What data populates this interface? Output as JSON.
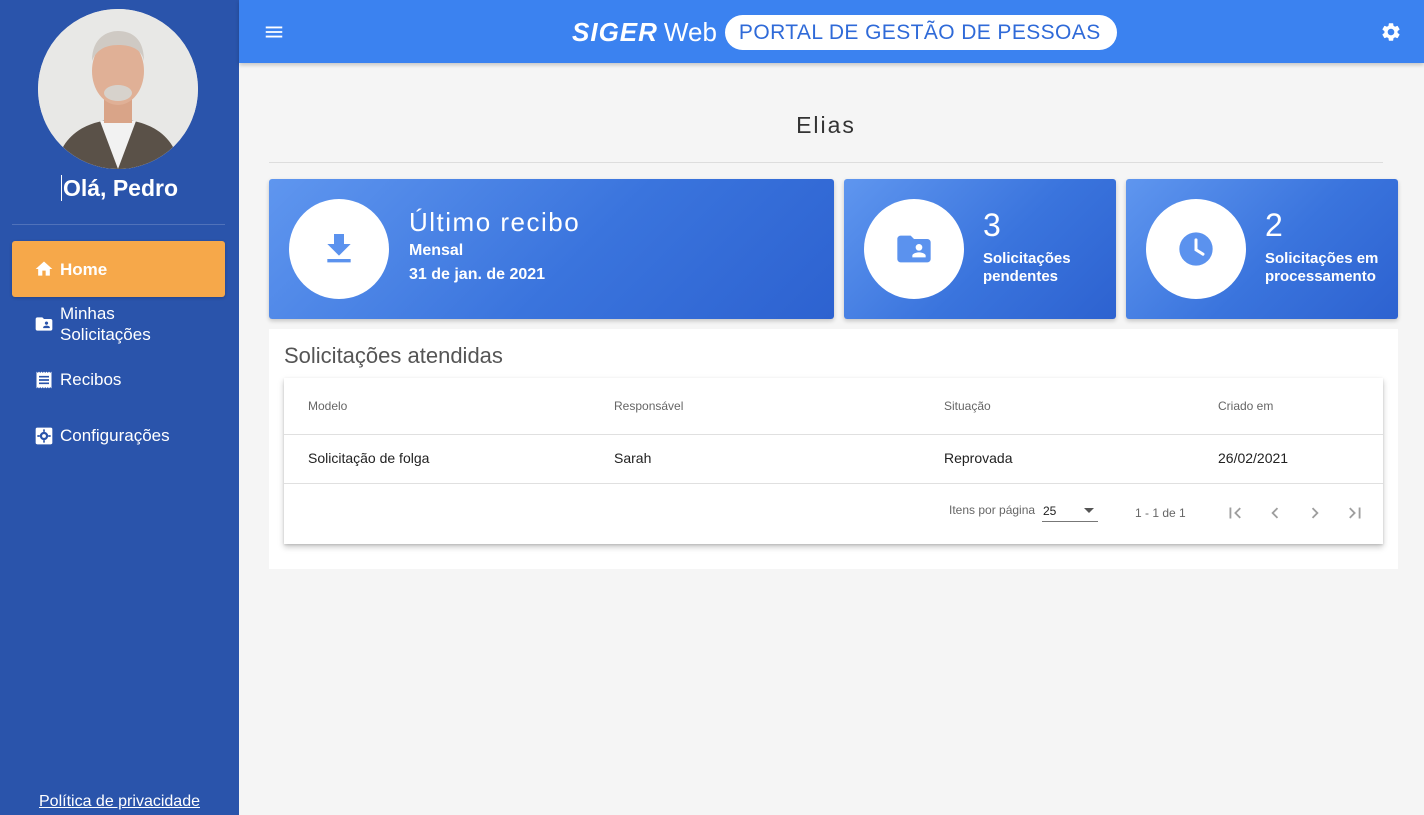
{
  "sidebar": {
    "greeting": "Olá, Pedro",
    "items": [
      {
        "label": "Home",
        "icon": "home-icon",
        "active": true
      },
      {
        "label_line1": "Minhas",
        "label_line2": "Solicitações",
        "icon": "folder-user-icon"
      },
      {
        "label": "Recibos",
        "icon": "receipt-icon"
      },
      {
        "label": "Configurações",
        "icon": "settings-box-icon"
      }
    ],
    "privacy_link": "Política de privacidade"
  },
  "header": {
    "brand_siger": "SIGER",
    "brand_web": "Web",
    "subtitle": "PORTAL DE GESTÃO DE PESSOAS",
    "menu_icon": "menu-icon",
    "settings_icon": "gear-icon"
  },
  "main": {
    "title": "Elias",
    "cards": [
      {
        "title": "Último recibo",
        "line1": "Mensal",
        "line2": "31 de jan. de 2021",
        "icon": "download-icon"
      },
      {
        "count": "3",
        "desc": "Solicitações pendentes",
        "icon": "folder-account-icon"
      },
      {
        "count": "2",
        "desc": "Solicitações em processamento",
        "icon": "clock-icon"
      }
    ],
    "section_title": "Solicitações atendidas",
    "table": {
      "headers": [
        "Modelo",
        "Responsável",
        "Situação",
        "Criado em"
      ],
      "rows": [
        [
          "Solicitação de folga",
          "Sarah",
          "Reprovada",
          "26/02/2021"
        ]
      ]
    },
    "paginator": {
      "items_label": "Itens por página",
      "page_size": "25",
      "range": "1 - 1 de 1"
    }
  },
  "colors": {
    "sidebar_bg": "#2a54ab",
    "topbar_bg": "#3b82f0",
    "active_item": "#f6a84a",
    "card_icon": "#5b92ee"
  }
}
